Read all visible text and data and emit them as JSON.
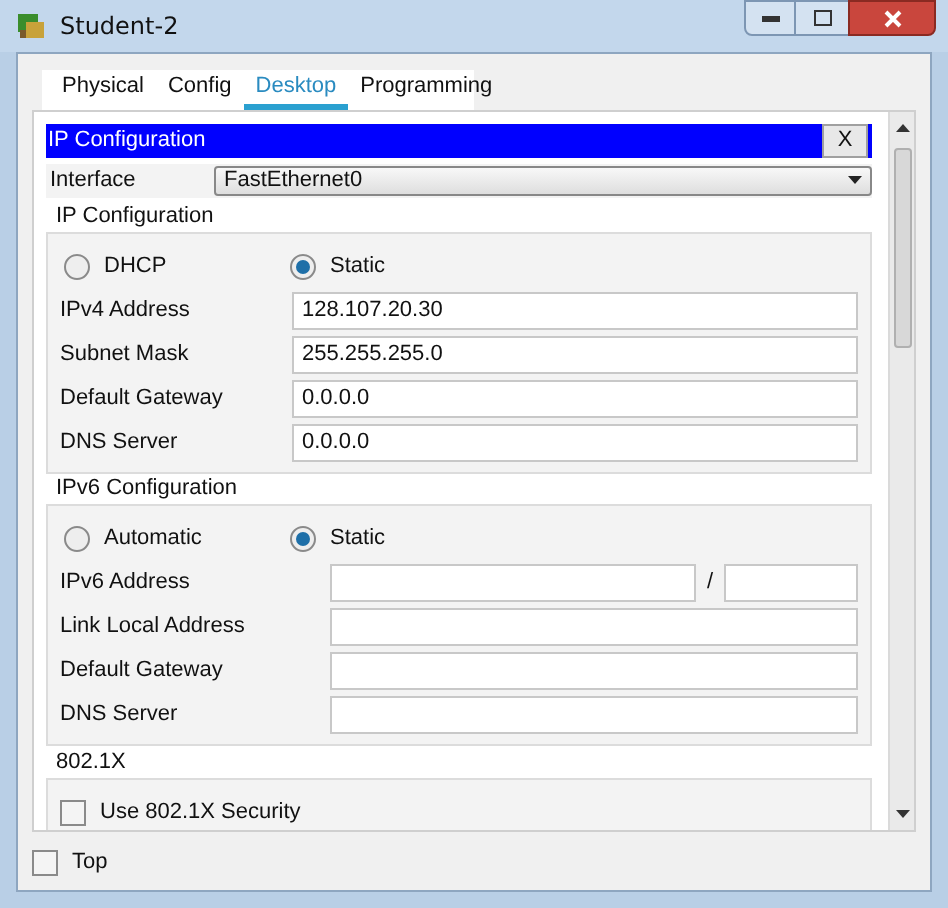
{
  "window": {
    "title": "Student-2"
  },
  "tabs": [
    {
      "label": "Physical",
      "selected": false
    },
    {
      "label": "Config",
      "selected": false
    },
    {
      "label": "Desktop",
      "selected": true
    },
    {
      "label": "Programming",
      "selected": false
    }
  ],
  "ip_configuration": {
    "title": "IP Configuration",
    "close": "X",
    "interface_label": "Interface",
    "interface_value": "FastEthernet0",
    "ipv4": {
      "title": "IP Configuration",
      "modes": [
        {
          "label": "DHCP",
          "selected": false
        },
        {
          "label": "Static",
          "selected": true
        }
      ],
      "fields": [
        {
          "label": "IPv4 Address",
          "value": "128.107.20.30"
        },
        {
          "label": "Subnet Mask",
          "value": "255.255.255.0"
        },
        {
          "label": "Default Gateway",
          "value": "0.0.0.0"
        },
        {
          "label": "DNS Server",
          "value": "0.0.0.0"
        }
      ]
    },
    "ipv6": {
      "title": "IPv6 Configuration",
      "modes": [
        {
          "label": "Automatic",
          "selected": false
        },
        {
          "label": "Static",
          "selected": true
        }
      ],
      "fields": [
        {
          "label": "IPv6 Address",
          "kind": "prefixed",
          "separator": "/"
        },
        {
          "label": "Link Local Address",
          "kind": "plain"
        },
        {
          "label": "Default Gateway",
          "kind": "plain"
        },
        {
          "label": "DNS Server",
          "kind": "plain"
        }
      ]
    },
    "dot1x": {
      "title": "802.1X",
      "checkbox": {
        "label": "Use 802.1X Security",
        "checked": false
      }
    }
  },
  "top_checkbox": {
    "label": "Top",
    "checked": false
  }
}
